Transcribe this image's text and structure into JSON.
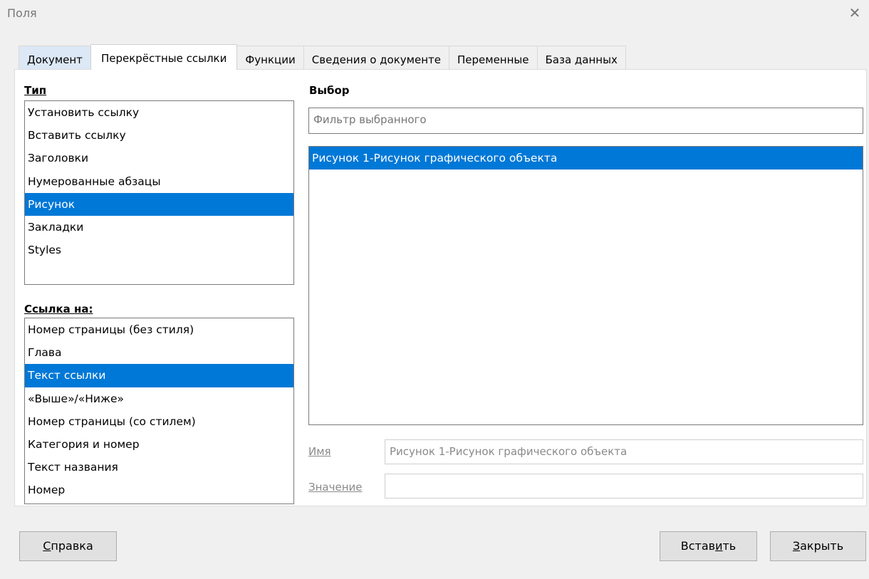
{
  "window": {
    "title": "Поля",
    "close_glyph": "✕"
  },
  "tabs": [
    {
      "label": "Документ"
    },
    {
      "label": "Перекрёстные ссылки"
    },
    {
      "label": "Функции"
    },
    {
      "label": "Сведения о документе"
    },
    {
      "label": "Переменные"
    },
    {
      "label": "База данных"
    }
  ],
  "type_section": {
    "label": "Тип",
    "items": [
      "Установить ссылку",
      "Вставить ссылку",
      "Заголовки",
      "Нумерованные абзацы",
      "Рисунок",
      "Закладки",
      "Styles"
    ],
    "selected_index": 4
  },
  "ref_section": {
    "label": "Ссылка на:",
    "items": [
      "Номер страницы (без стиля)",
      "Глава",
      "Текст ссылки",
      "«Выше»/«Ниже»",
      "Номер страницы (со стилем)",
      "Категория и номер",
      "Текст названия",
      "Номер"
    ],
    "selected_index": 2
  },
  "selection_section": {
    "label": "Выбор",
    "filter_placeholder": "Фильтр выбранного",
    "items": [
      "Рисунок 1-Рисунок графического объекта"
    ],
    "selected_index": 0
  },
  "fields": {
    "name_label": "Имя",
    "name_value": "Рисунок 1-Рисунок графического объекта",
    "value_label": "Значение",
    "value_value": ""
  },
  "buttons": {
    "help": {
      "accel": "С",
      "rest": "правка"
    },
    "insert": {
      "pre": "Встав",
      "accel": "и",
      "post": "ть"
    },
    "close": {
      "accel": "З",
      "rest": "акрыть"
    }
  },
  "colors": {
    "selection": "#0078d7",
    "first_tab_bg": "#dce8f5"
  }
}
